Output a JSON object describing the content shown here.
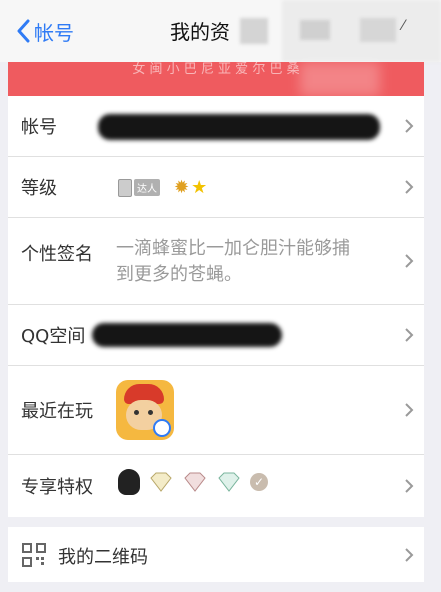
{
  "nav": {
    "back_label": "帐号",
    "title": "我的资"
  },
  "banner": {
    "text": "女 闽 小 巴 尼 亚 爱 尔 巴 桑"
  },
  "rows": {
    "account": {
      "label": "帐号"
    },
    "level": {
      "label": "等级",
      "badge": "达人"
    },
    "signature": {
      "label": "个性签名",
      "line1": "一滴蜂蜜比一加仑胆汁能够捕",
      "line2": "到更多的苍蝇。"
    },
    "qzone": {
      "label": "QQ空间"
    },
    "recent": {
      "label": "最近在玩"
    },
    "privileges": {
      "label": "专享特权"
    }
  },
  "qr": {
    "label": "我的二维码"
  },
  "colors": {
    "accent": "#2f7bf5",
    "banner": "#ef5b5f",
    "text": "#333333",
    "secondary": "#9a9a9a"
  }
}
